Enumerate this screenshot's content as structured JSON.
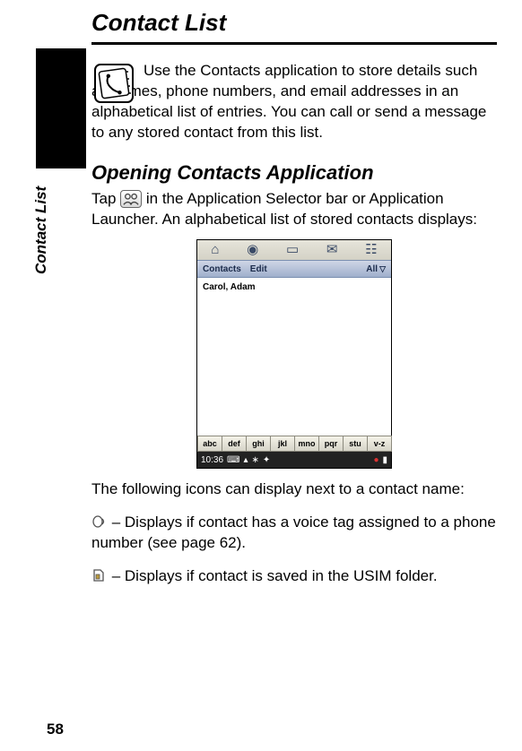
{
  "page_number": "58",
  "side_label": "Contact List",
  "chapter_title": "Contact List",
  "intro": "Use the Contacts application to store details such as names, phone numbers, and email addresses in an alphabetical list of entries. You can call or send a message to any stored contact from this list.",
  "section_title": "Opening Contacts Application",
  "tap_pre": "Tap ",
  "tap_post": " in the Application Selector bar or Application Launcher. An alphabetical list of stored contacts displays:",
  "device": {
    "menu": {
      "contacts": "Contacts",
      "edit": "Edit",
      "all": "All"
    },
    "first_contact": "Carol, Adam",
    "index": [
      "abc",
      "def",
      "ghi",
      "jkl",
      "mno",
      "pqr",
      "stu",
      "v-z"
    ],
    "time": "10:36"
  },
  "following_text": "The following icons can display next to a contact name:",
  "voice_tag_desc": " – Displays if contact has a voice tag assigned to a phone number (see page 62).",
  "usim_desc": " – Displays if contact is saved in the USIM folder."
}
